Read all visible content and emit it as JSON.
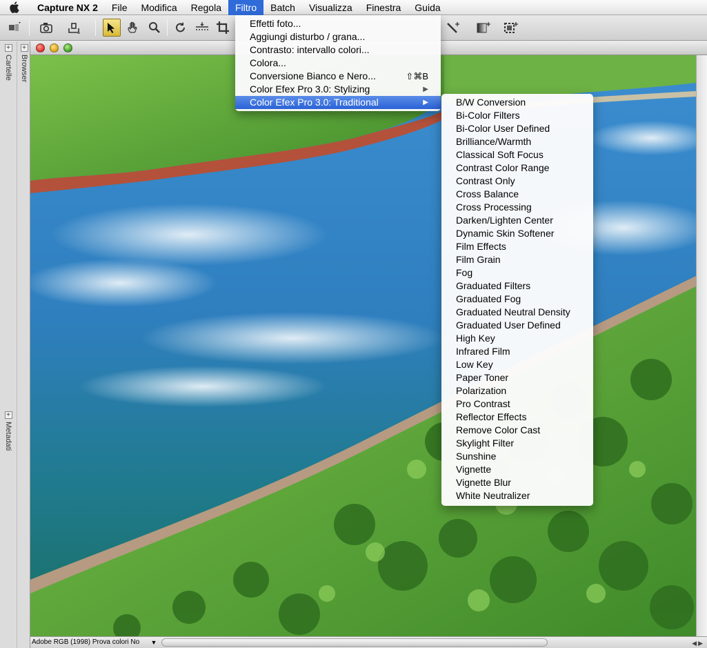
{
  "menubar": {
    "app_name": "Capture NX 2",
    "items": [
      "File",
      "Modifica",
      "Regola",
      "Filtro",
      "Batch",
      "Visualizza",
      "Finestra",
      "Guida"
    ]
  },
  "sidebar": {
    "tabs": [
      "Cartelle",
      "Browser",
      "Metadati"
    ]
  },
  "filtro_menu": {
    "items": [
      {
        "label": "Effetti foto...",
        "shortcut": "",
        "submenu": false
      },
      {
        "label": "Aggiungi disturbo / grana...",
        "shortcut": "",
        "submenu": false
      },
      {
        "label": "Contrasto: intervallo colori...",
        "shortcut": "",
        "submenu": false
      },
      {
        "label": "Colora...",
        "shortcut": "",
        "submenu": false
      },
      {
        "label": "Conversione Bianco e Nero...",
        "shortcut": "⇧⌘B",
        "submenu": false
      },
      {
        "label": "Color Efex Pro 3.0: Stylizing",
        "shortcut": "",
        "submenu": true
      },
      {
        "label": "Color Efex Pro 3.0: Traditional",
        "shortcut": "",
        "submenu": true,
        "selected": true
      }
    ]
  },
  "traditional_submenu": {
    "items": [
      "B/W Conversion",
      "Bi-Color Filters",
      "Bi-Color User Defined",
      "Brilliance/Warmth",
      "Classical Soft Focus",
      "Contrast Color Range",
      "Contrast Only",
      "Cross Balance",
      "Cross Processing",
      "Darken/Lighten Center",
      "Dynamic Skin Softener",
      "Film Effects",
      "Film Grain",
      "Fog",
      "Graduated Filters",
      "Graduated Fog",
      "Graduated Neutral Density",
      "Graduated User Defined",
      "High Key",
      "Infrared Film",
      "Low Key",
      "Paper Toner",
      "Polarization",
      "Pro Contrast",
      "Reflector Effects",
      "Remove Color Cast",
      "Skylight Filter",
      "Sunshine",
      "Vignette",
      "Vignette Blur",
      "White Neutralizer"
    ]
  },
  "statusbar": {
    "profile": "Adobe RGB (1998)  Prova colori No"
  },
  "colors": {
    "menu_highlight": "#2f6bd9",
    "water": "#2f7fc0",
    "grass": "#5aa032"
  }
}
